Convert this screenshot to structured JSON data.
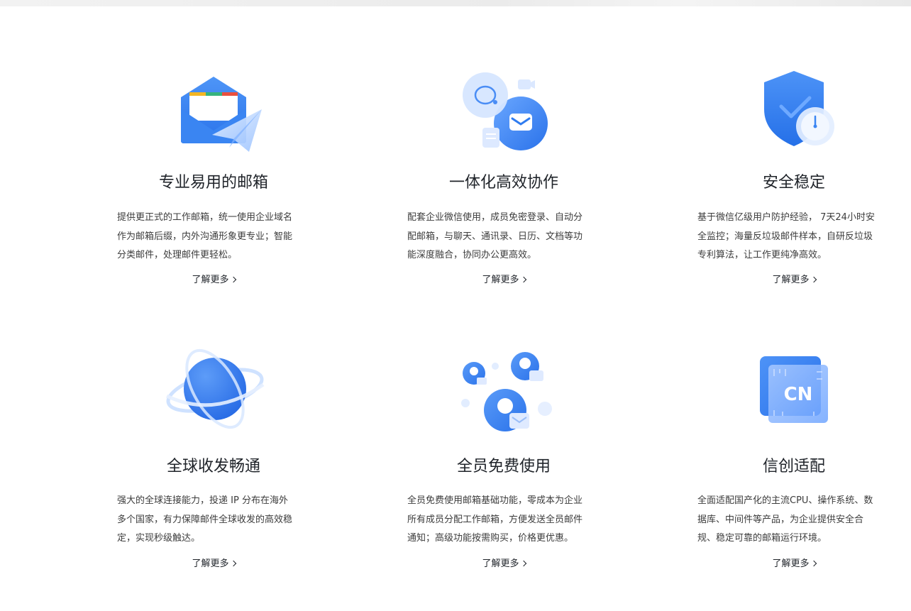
{
  "features": [
    {
      "title": "专业易用的邮箱",
      "desc": [
        "提供更正式的工作邮箱，统一使用企业域名",
        "作为邮箱后缀，内外沟通形象更专业；智能",
        "分类邮件，处理邮件更轻松。"
      ],
      "more": "了解更多",
      "icon": "envelope-paper-plane-icon"
    },
    {
      "title": "一体化高效协作",
      "desc": [
        "配套企业微信使用，成员免密登录、自动分",
        "配邮箱，与聊天、通讯录、日历、文档等功",
        "能深度融合，协同办公更高效。"
      ],
      "more": "了解更多",
      "icon": "chat-mail-collaboration-icon"
    },
    {
      "title": "安全稳定",
      "desc": [
        "基于微信亿级用户防护经验， 7天24小时安",
        "全监控；海量反垃圾邮件样本，自研反垃圾",
        "专利算法，让工作更纯净高效。"
      ],
      "more": "了解更多",
      "icon": "shield-clock-icon"
    },
    {
      "title": "全球收发畅通",
      "desc": [
        "强大的全球连接能力，投递 IP 分布在海外",
        "多个国家，有力保障邮件全球收发的高效稳",
        "定，实现秒级触达。"
      ],
      "more": "了解更多",
      "icon": "globe-orbit-icon"
    },
    {
      "title": "全员免费使用",
      "desc": [
        "全员免费使用邮箱基础功能，零成本为企业",
        "所有成员分配工作邮箱，方便发送全员邮件",
        "通知；高级功能按需购买，价格更优惠。"
      ],
      "more": "了解更多",
      "icon": "users-mail-icon"
    },
    {
      "title": "信创适配",
      "desc": [
        "全面适配国产化的主流CPU、操作系统、数",
        "据库、中间件等产品，为企业提供安全合",
        "规、稳定可靠的邮箱运行环境。"
      ],
      "more": "了解更多",
      "icon": "cn-chip-icon",
      "chip_text": "CN"
    }
  ],
  "colors": {
    "primary_blue": "#2f7cf0",
    "light_blue": "#cfe2ff",
    "text": "#1f2329",
    "desc_text": "#3c3c3c"
  }
}
